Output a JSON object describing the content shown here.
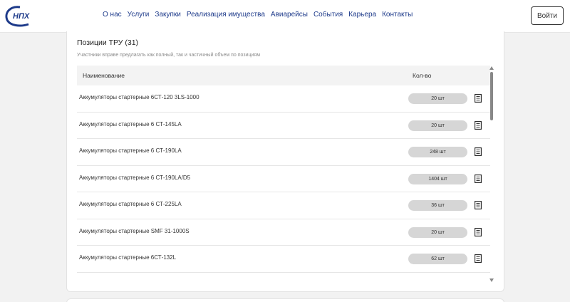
{
  "header": {
    "logo_text": "НПХ",
    "nav": [
      "О нас",
      "Услуги",
      "Закупки",
      "Реализация имущества",
      "Авиарейсы",
      "События",
      "Карьера",
      "Контакты"
    ],
    "login_label": "Войти"
  },
  "card": {
    "title": "Позиции ТРУ (31)",
    "subtitle": "Участники вправе предлагать как полный, так и частичный объем по позициям",
    "col_name": "Наименование",
    "col_qty": "Кол-во",
    "rows": [
      {
        "name": "Аккумуляторы стартерные 6СТ-120 3LS-1000",
        "qty": "20 шт"
      },
      {
        "name": "Аккумуляторы стартерные 6 СТ-145LA",
        "qty": "20 шт"
      },
      {
        "name": "Аккумуляторы стартерные 6 СТ-190LA",
        "qty": "248 шт"
      },
      {
        "name": "Аккумуляторы стартерные 6 СТ-190LA/D5",
        "qty": "1404 шт"
      },
      {
        "name": "Аккумуляторы стартерные 6 СТ-225LA",
        "qty": "36 шт"
      },
      {
        "name": "Аккумуляторы стартерные SMF 31-1000S",
        "qty": "20 шт"
      },
      {
        "name": "Аккумуляторы стартерные 6СТ-132L",
        "qty": "62 шт"
      }
    ]
  },
  "colors": {
    "accent": "#1d3a8a",
    "pill": "#d6d6d6"
  }
}
